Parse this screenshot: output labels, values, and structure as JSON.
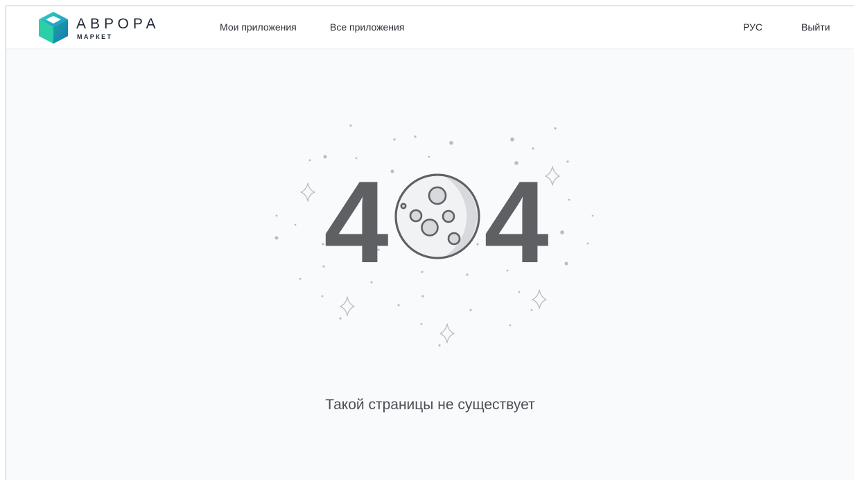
{
  "header": {
    "brand_title": "АВРОРА",
    "brand_subtitle": "МАРКЕТ",
    "nav": {
      "my_apps": "Мои приложения",
      "all_apps": "Все приложения"
    },
    "language": "РУС",
    "logout": "Выйти"
  },
  "error": {
    "digit_left": "4",
    "digit_right": "4",
    "message": "Такой страницы не существует"
  },
  "colors": {
    "brand_teal": "#1fb8a9",
    "digits": "#5f6064",
    "moon_fill": "#f1f2f4",
    "moon_shadow": "#d7dadd",
    "stars": "#b8bcc2"
  },
  "icons": {
    "logo": "aurora-cube-logo",
    "moon": "moon-icon",
    "sparkle": "sparkle-star-icon"
  }
}
